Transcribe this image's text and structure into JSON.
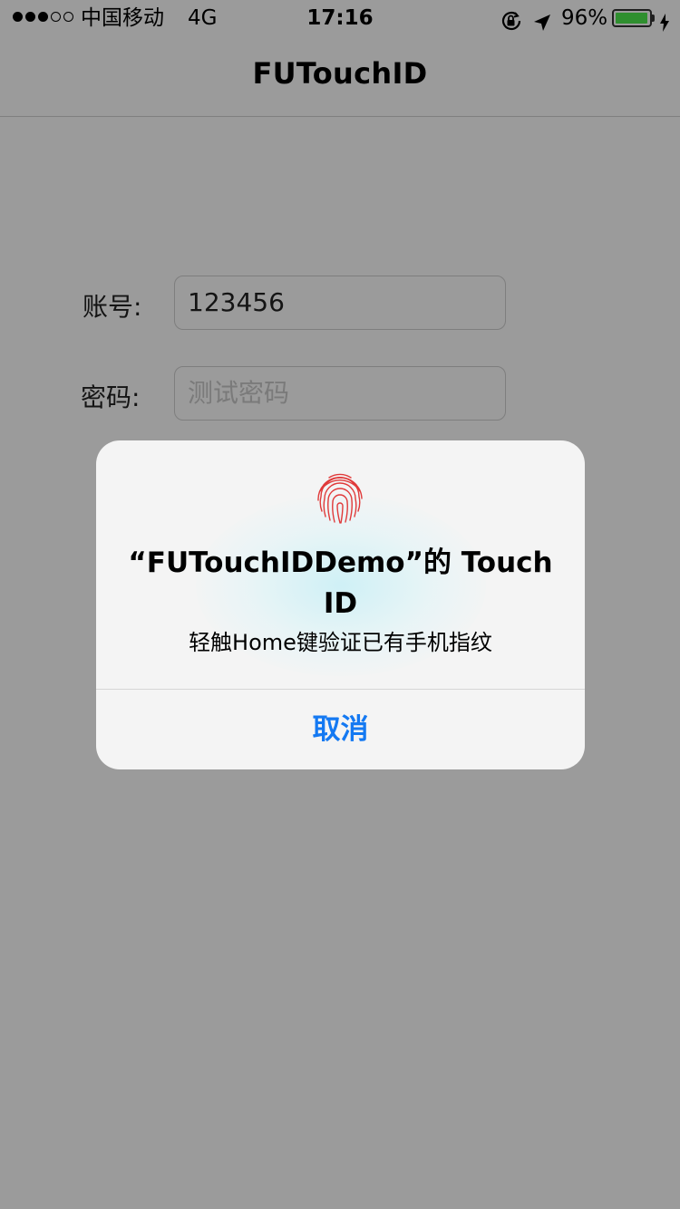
{
  "status_bar": {
    "signal_bars": 3,
    "signal_total": 5,
    "carrier": "中国移动",
    "network": "4G",
    "time": "17:16",
    "battery_percent": "96%",
    "battery_level": 0.96,
    "icons": [
      "rotation-lock-icon",
      "location-arrow-icon",
      "battery-icon",
      "charging-bolt-icon"
    ]
  },
  "nav": {
    "title": "FUTouchID"
  },
  "form": {
    "account_label": "账号:",
    "account_value": "123456",
    "password_label": "密码:",
    "password_placeholder": "测试密码"
  },
  "alert": {
    "icon": "fingerprint-icon",
    "title": "“FUTouchIDDemo”的 Touch ID",
    "message": "轻触Home键验证已有手机指纹",
    "cancel_label": "取消"
  },
  "colors": {
    "dim_background": "#9b9b9b",
    "alert_background": "#f4f4f4",
    "accent_blue": "#1479f2",
    "fingerprint_red": "#e03a3a",
    "battery_green": "#2f8f2f"
  }
}
